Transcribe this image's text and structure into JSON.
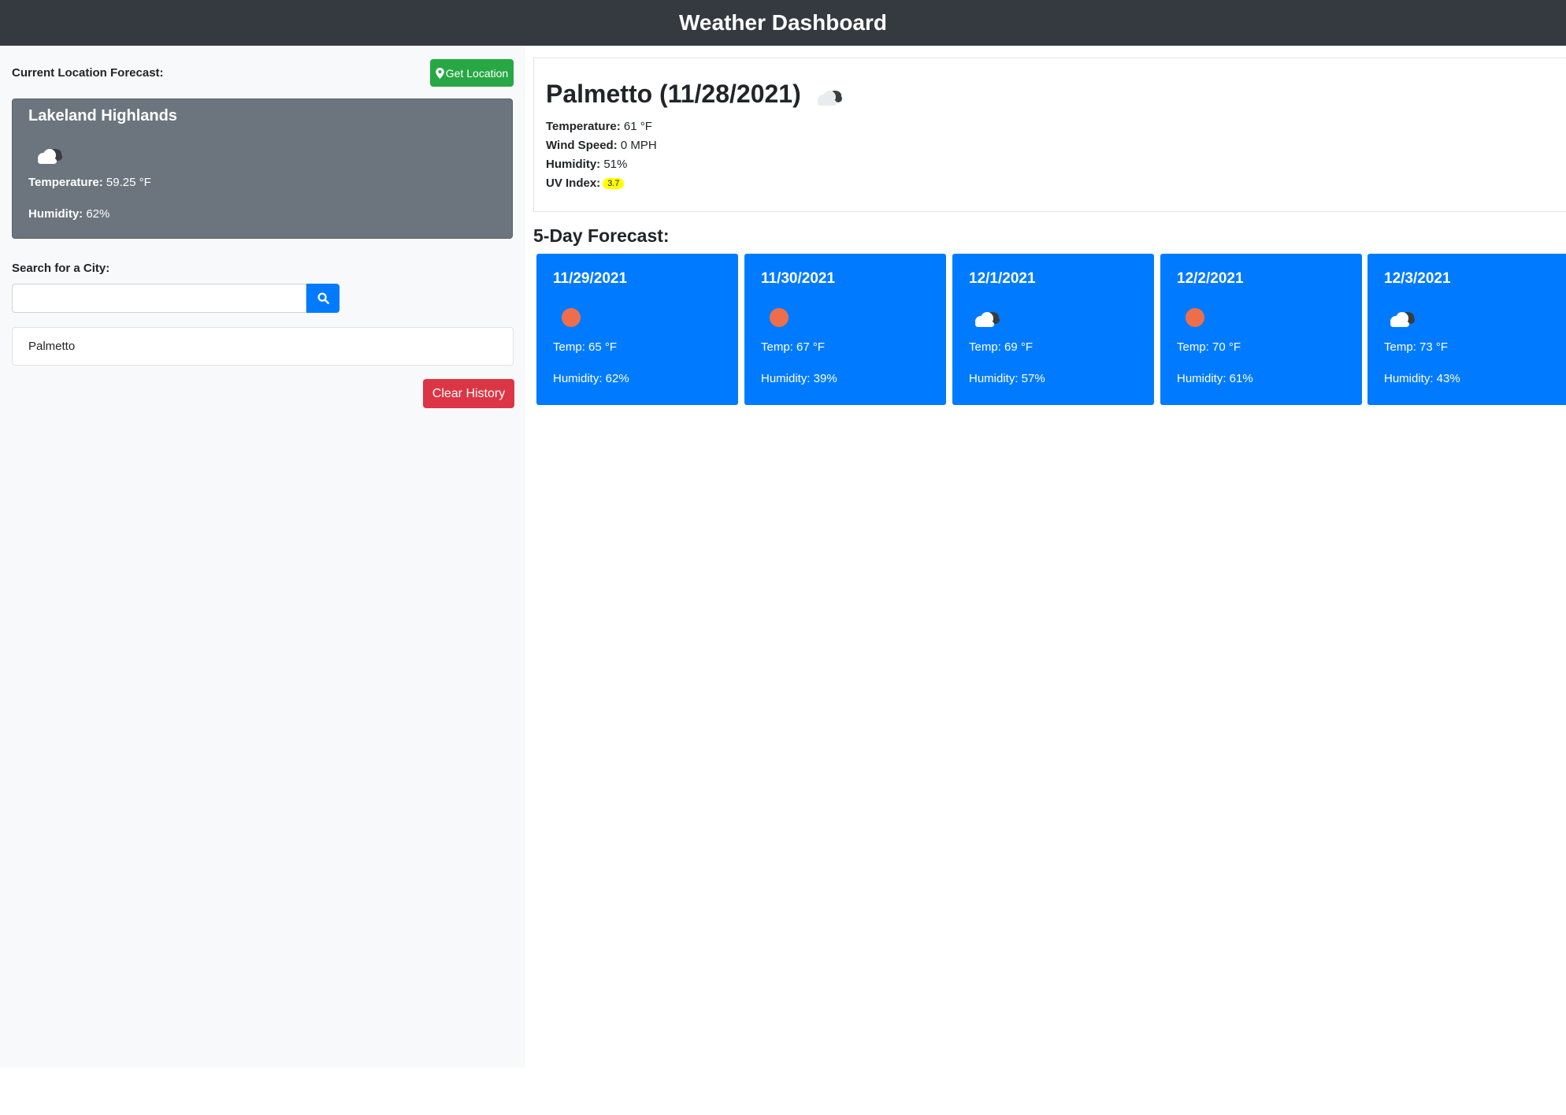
{
  "header": {
    "title": "Weather Dashboard"
  },
  "sidebar": {
    "current_label": "Current Location Forecast:",
    "get_location_label": "Get Location",
    "location_card": {
      "city": "Lakeland Highlands",
      "icon": "cloud-icon",
      "temperature_label": "Temperature:",
      "temperature_value": " 59.25 °F",
      "humidity_label": "Humidity:",
      "humidity_value": " 62%"
    },
    "search_label": "Search for a City:",
    "search_value": "",
    "history": [
      "Palmetto"
    ],
    "clear_label": "Clear History"
  },
  "current": {
    "title": "Palmetto (11/28/2021)",
    "icon": "cloud-icon",
    "temperature_label": "Temperature:",
    "temperature_value": " 61 °F",
    "wind_label": "Wind Speed:",
    "wind_value": " 0 MPH",
    "humidity_label": "Humidity:",
    "humidity_value": " 51%",
    "uv_label": "UV Index:",
    "uv_value": "3.7",
    "uv_color": "#ffff00"
  },
  "forecast": {
    "title": "5-Day Forecast:",
    "days": [
      {
        "date": "11/29/2021",
        "icon": "sun-icon",
        "temp": "Temp: 65 °F",
        "humidity": "Humidity: 62%"
      },
      {
        "date": "11/30/2021",
        "icon": "sun-icon",
        "temp": "Temp: 67 °F",
        "humidity": "Humidity: 39%"
      },
      {
        "date": "12/1/2021",
        "icon": "cloud-icon",
        "temp": "Temp: 69 °F",
        "humidity": "Humidity: 57%"
      },
      {
        "date": "12/2/2021",
        "icon": "sun-icon",
        "temp": "Temp: 70 °F",
        "humidity": "Humidity: 61%"
      },
      {
        "date": "12/3/2021",
        "icon": "cloud-icon",
        "temp": "Temp: 73 °F",
        "humidity": "Humidity: 43%"
      }
    ]
  },
  "colors": {
    "header_bg": "#343a40",
    "card_blue": "#007bff",
    "location_card_bg": "#6c757d",
    "green_button": "#28a745",
    "red_button": "#dc3545",
    "sun": "#ee6e4b"
  }
}
